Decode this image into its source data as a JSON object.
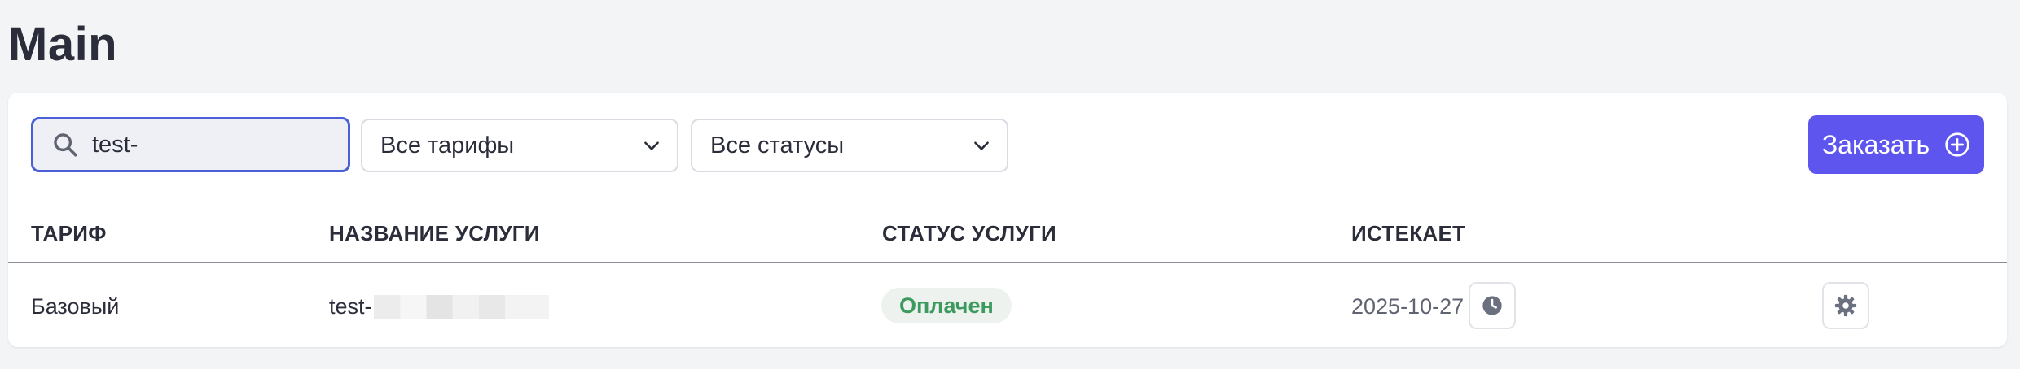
{
  "page": {
    "title": "Main"
  },
  "filters": {
    "search_value": "test-",
    "tariff_select": "Все тарифы",
    "status_select": "Все статусы"
  },
  "order_button": {
    "label": "Заказать",
    "color": "#5d55ee"
  },
  "table": {
    "columns": [
      "ТАРИФ",
      "НАЗВАНИЕ УСЛУГИ",
      "СТАТУС УСЛУГИ",
      "ИСТЕКАЕТ"
    ],
    "rows": [
      {
        "tariff": "Базовый",
        "service_name": "test-",
        "status": "Оплачен",
        "expires": "2025-10-27"
      }
    ]
  },
  "colors": {
    "accent": "#5d55ee",
    "status_paid": "#3c9a5f",
    "focus_border": "#4b5fd6"
  },
  "icons": [
    "search-icon",
    "chevron-down-icon",
    "plus-circle-icon",
    "clock-icon",
    "gear-icon"
  ]
}
